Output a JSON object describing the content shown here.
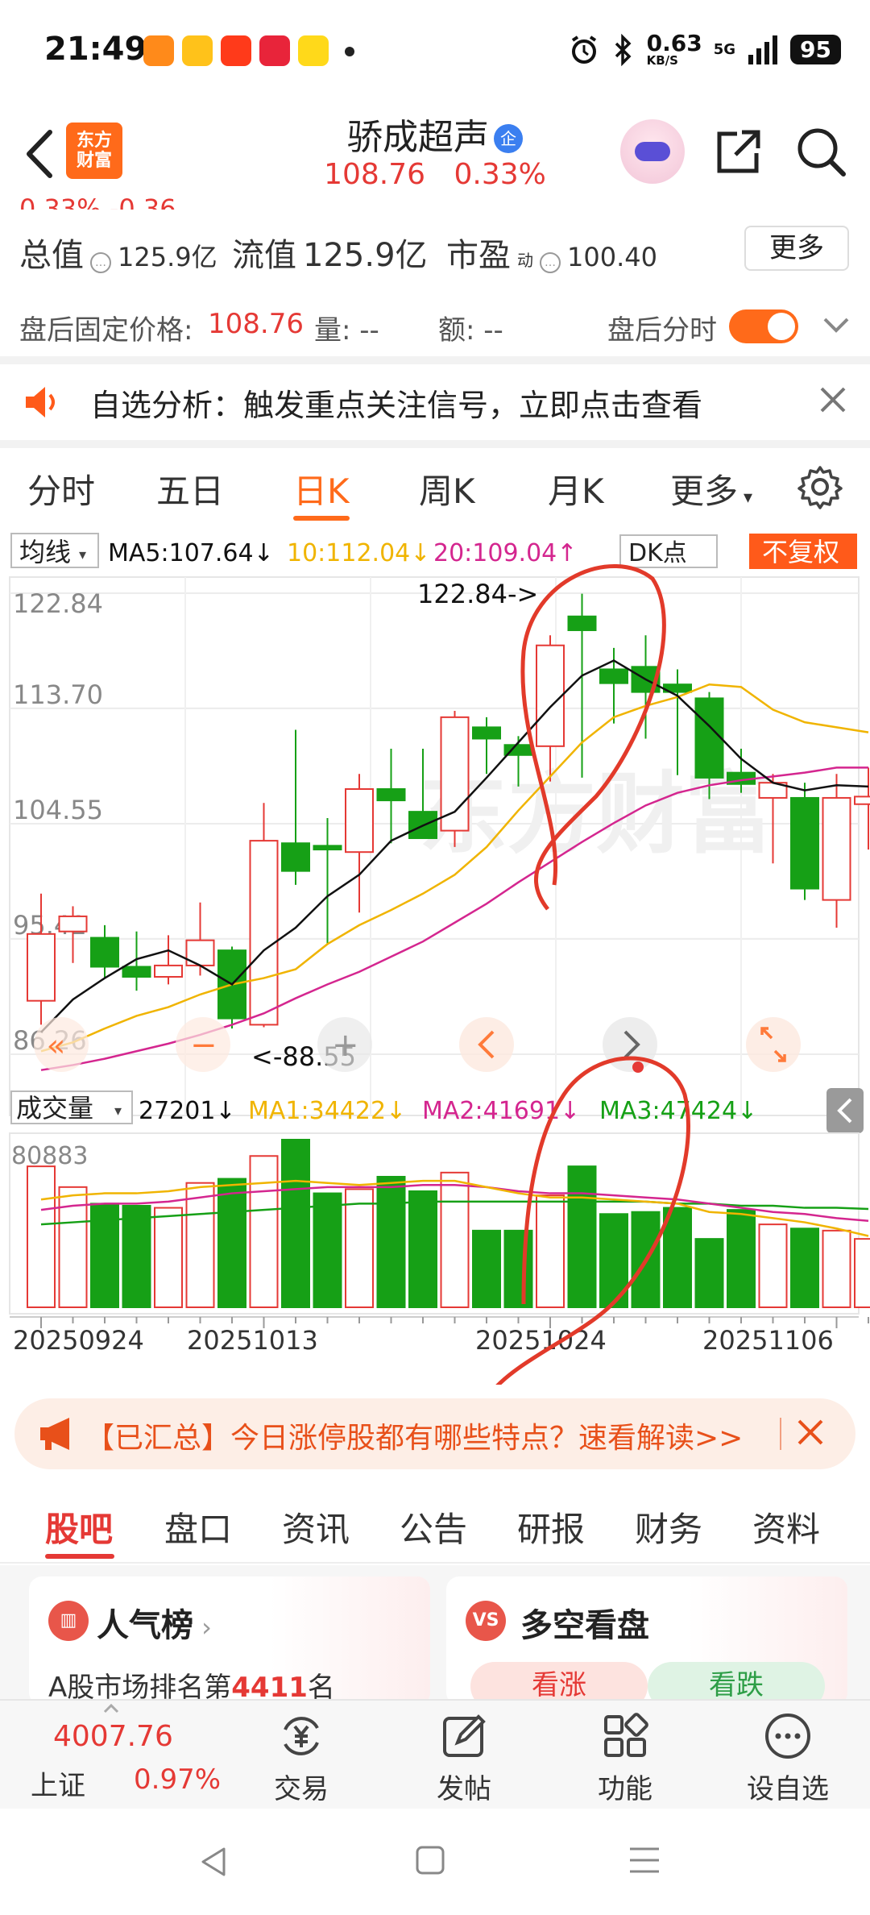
{
  "status_bar": {
    "time": "21:49",
    "apps": [
      "红包",
      "饿了么",
      "淘宝",
      "拼多多",
      "闲鱼"
    ],
    "net_speed": "0.63",
    "net_unit": "KB/S",
    "signal": "5G",
    "battery": "95"
  },
  "header": {
    "brand": [
      "东方",
      "财富"
    ],
    "stock_name": "骄成超声",
    "company_badge": "企",
    "price": "108.76",
    "change_pct": "0.33%"
  },
  "summary": {
    "cut_text": "0.33%   -0.36",
    "total_value_label": "总值",
    "total_value": "125.9亿",
    "float_value_label": "流值",
    "float_value": "125.9亿",
    "pe_label": "市盈",
    "pe_sup": "动",
    "pe_value": "100.40",
    "more_button": "更多"
  },
  "after_hours": {
    "fixed_price_label": "盘后固定价格:",
    "fixed_price": "108.76",
    "volume_label": "量: --",
    "amount_label": "额: --",
    "timeshare_label": "盘后分时"
  },
  "notice": {
    "text": "自选分析：触发重点关注信号，立即点击查看"
  },
  "period_tabs": [
    "分时",
    "五日",
    "日K",
    "周K",
    "月K",
    "更多"
  ],
  "period_active": "日K",
  "chart_header": {
    "ma_selector": "均线",
    "ma5": "MA5:107.64↓",
    "ma10": "10:112.04↓",
    "ma20": "20:109.04↑",
    "dk_button": "DK点",
    "adjust_button": "不复权"
  },
  "chart_labels": {
    "y_ticks": [
      "122.84",
      "113.70",
      "104.55",
      "95.41",
      "86.26"
    ],
    "max_marker": "122.84->",
    "min_marker": "<-88.55",
    "volume_selector": "成交量",
    "volume_value": "27201↓",
    "vma1": "MA1:34422↓",
    "vma2": "MA2:41691↓",
    "vma3": "MA3:47424↓",
    "volume_top": "80883",
    "dates": [
      "20250924",
      "20251013",
      "20251024",
      "20251106"
    ]
  },
  "chart_data": {
    "type": "candlestick",
    "price_range": [
      86.26,
      122.84
    ],
    "volume_max": 80883,
    "candles": [
      {
        "o": 90.5,
        "h": 99.0,
        "l": 88.6,
        "c": 95.8
      },
      {
        "o": 96.0,
        "h": 98.0,
        "l": 93.5,
        "c": 97.2
      },
      {
        "o": 95.5,
        "h": 96.5,
        "l": 92.3,
        "c": 93.2
      },
      {
        "o": 93.2,
        "h": 96.0,
        "l": 91.3,
        "c": 92.4
      },
      {
        "o": 92.4,
        "h": 95.7,
        "l": 91.8,
        "c": 93.3
      },
      {
        "o": 93.3,
        "h": 98.3,
        "l": 92.5,
        "c": 95.3
      },
      {
        "o": 94.5,
        "h": 94.8,
        "l": 88.3,
        "c": 89.1
      },
      {
        "o": 88.6,
        "h": 106.2,
        "l": 88.4,
        "c": 103.2
      },
      {
        "o": 103.0,
        "h": 112.0,
        "l": 99.7,
        "c": 100.8
      },
      {
        "o": 102.8,
        "h": 105.0,
        "l": 95.0,
        "c": 102.5
      },
      {
        "o": 102.3,
        "h": 108.5,
        "l": 97.5,
        "c": 107.3
      },
      {
        "o": 107.3,
        "h": 110.5,
        "l": 103.0,
        "c": 106.4
      },
      {
        "o": 105.5,
        "h": 110.5,
        "l": 103.5,
        "c": 103.4
      },
      {
        "o": 104.0,
        "h": 113.5,
        "l": 102.7,
        "c": 113.0
      },
      {
        "o": 112.2,
        "h": 113.0,
        "l": 108.5,
        "c": 111.3
      },
      {
        "o": 110.8,
        "h": 111.5,
        "l": 107.5,
        "c": 110.0
      },
      {
        "o": 110.7,
        "h": 119.5,
        "l": 107.9,
        "c": 118.7
      },
      {
        "o": 121.0,
        "h": 122.8,
        "l": 108.2,
        "c": 119.9
      },
      {
        "o": 116.8,
        "h": 118.5,
        "l": 112.5,
        "c": 115.7
      },
      {
        "o": 117.0,
        "h": 119.5,
        "l": 111.3,
        "c": 115.0
      },
      {
        "o": 115.6,
        "h": 116.8,
        "l": 108.4,
        "c": 115.0
      },
      {
        "o": 114.5,
        "h": 115.0,
        "l": 106.5,
        "c": 108.2
      },
      {
        "o": 108.6,
        "h": 110.5,
        "l": 107.0,
        "c": 107.7
      },
      {
        "o": 106.6,
        "h": 108.5,
        "l": 101.4,
        "c": 107.8
      },
      {
        "o": 106.6,
        "h": 107.8,
        "l": 98.5,
        "c": 99.4
      },
      {
        "o": 98.5,
        "h": 108.5,
        "l": 96.3,
        "c": 106.6
      },
      {
        "o": 106.1,
        "h": 109.0,
        "l": 102.5,
        "c": 106.7
      }
    ],
    "ma5": [
      88.0,
      90.6,
      92.3,
      93.8,
      94.5,
      93.3,
      91.8,
      94.5,
      96.3,
      98.8,
      100.5,
      103.2,
      104.4,
      105.5,
      108.2,
      111.0,
      113.8,
      116.3,
      117.5,
      116.0,
      114.7,
      112.3,
      109.7,
      107.8,
      107.2,
      107.6,
      107.5
    ],
    "ma10": [
      86.5,
      87.2,
      88.3,
      89.3,
      90.0,
      91.0,
      91.8,
      92.3,
      93.0,
      95.0,
      96.5,
      97.7,
      99.0,
      100.5,
      102.7,
      105.6,
      108.3,
      111.0,
      113.0,
      113.9,
      114.6,
      115.6,
      115.4,
      113.6,
      112.6,
      112.2,
      111.8
    ],
    "ma20": [
      85.0,
      85.4,
      85.9,
      86.5,
      87.1,
      87.8,
      88.6,
      89.5,
      90.7,
      91.8,
      92.8,
      94.0,
      95.2,
      96.7,
      98.2,
      99.9,
      101.5,
      103.1,
      104.6,
      106.0,
      107.0,
      107.6,
      108.0,
      108.3,
      108.6,
      109.0,
      109.0
    ],
    "volumes": [
      68000,
      58000,
      50000,
      49000,
      48000,
      60000,
      62000,
      73000,
      80883,
      55000,
      57000,
      63000,
      56000,
      65000,
      37000,
      37000,
      54000,
      68000,
      45000,
      46000,
      48000,
      33000,
      47000,
      40000,
      38000,
      37000,
      33000
    ],
    "vma1": [
      52000,
      54000,
      55000,
      55000,
      56000,
      58000,
      59000,
      60000,
      61000,
      60000,
      59000,
      60000,
      61000,
      61000,
      58000,
      55000,
      53000,
      53000,
      52000,
      51000,
      50000,
      46000,
      45000,
      43000,
      41000,
      38000,
      34422
    ],
    "vma2": [
      47000,
      49000,
      50000,
      50000,
      51000,
      53000,
      55000,
      56000,
      57000,
      58000,
      58000,
      58000,
      59000,
      59000,
      58000,
      56000,
      55000,
      55000,
      54000,
      53000,
      52000,
      50000,
      48000,
      46000,
      45000,
      43000,
      41691
    ],
    "vma3": [
      40000,
      41000,
      42000,
      43000,
      44000,
      45000,
      46000,
      47000,
      48000,
      49000,
      50000,
      50000,
      51000,
      51000,
      51000,
      51000,
      51000,
      51000,
      51000,
      51000,
      50000,
      50000,
      49000,
      49000,
      48000,
      48000,
      47424
    ],
    "up_color": "#e53935",
    "down_color": "#16a016",
    "ma5_color": "#111111",
    "ma10_color": "#f0b400",
    "ma20_color": "#d4268f"
  },
  "banner": {
    "text": "【已汇总】今日涨停股都有哪些特点？速看解读>>"
  },
  "sub_tabs": [
    "股吧",
    "盘口",
    "资讯",
    "公告",
    "研报",
    "财务",
    "资料"
  ],
  "sub_active": "股吧",
  "cards": {
    "popularity_title": "人气榜",
    "popularity_desc_prefix": "A股市场排名第",
    "popularity_rank": "4411",
    "popularity_desc_suffix": "名",
    "bullbear_title": "多空看盘",
    "bull_label": "看涨",
    "bear_label": "看跌"
  },
  "toolbar": {
    "index_value": "4007.76",
    "index_name": "上证",
    "index_pct": "0.97%",
    "items": [
      "交易",
      "发帖",
      "功能",
      "设自选"
    ]
  }
}
